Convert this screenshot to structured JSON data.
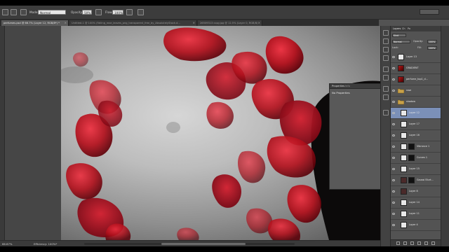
{
  "options_bar": {
    "mode_label": "Mode:",
    "mode_value": "Normal",
    "opacity_label": "Opacity:",
    "opacity_value": "50%",
    "flow_label": "Flow:",
    "flow_value": "100%"
  },
  "tabs": [
    {
      "label": "perfumes.psd @ 66.7% (Layer 12, RGB/8*) *",
      "active": true
    },
    {
      "label": "Untitled-1 @ 100% (Falling_rose_leaves_png_transparent_free_by_AbsolutelyStock.d...",
      "active": false
    },
    {
      "label": "26509313 copy.jpg @ 12.5% (Layer 0, RGB/8)",
      "active": false
    }
  ],
  "properties_panel": {
    "tab_properties": "Properties",
    "tab_info": "Info",
    "body_text": "No Properties"
  },
  "status_bar": {
    "zoom": "66.67%",
    "efficiency": "Efficiency: 100%*"
  },
  "layers_panel": {
    "tabs": [
      "Layers",
      "Ch",
      "Pa"
    ],
    "kind_label": "Kind",
    "blend_value": "Normal",
    "opacity_label": "Opacity:",
    "opacity_value": "100%",
    "fill_label": "Fill:",
    "fill_value": "100%",
    "lock_label": "Lock:",
    "layers": [
      {
        "name": "Layer 13",
        "thumb": "white",
        "selected": false,
        "mask": false,
        "indent": 0
      },
      {
        "name": "GRADIENT",
        "thumb": "red",
        "selected": false,
        "mask": false,
        "indent": 0
      },
      {
        "name": "perfume_top1_d...",
        "thumb": "red",
        "selected": false,
        "mask": false,
        "indent": 0
      },
      {
        "name": "rose",
        "thumb": "folder",
        "selected": false,
        "mask": false,
        "indent": 0
      },
      {
        "name": "shadow",
        "thumb": "folder",
        "selected": false,
        "mask": false,
        "indent": 0
      },
      {
        "name": "Layer 12",
        "thumb": "white",
        "selected": true,
        "mask": false,
        "indent": 1
      },
      {
        "name": "Layer 17",
        "thumb": "white",
        "selected": false,
        "mask": false,
        "indent": 1
      },
      {
        "name": "Layer 16",
        "thumb": "white",
        "selected": false,
        "mask": false,
        "indent": 1
      },
      {
        "name": "Vibrance 1",
        "thumb": "white",
        "selected": false,
        "mask": true,
        "indent": 1
      },
      {
        "name": "Curves 1",
        "thumb": "white",
        "selected": false,
        "mask": true,
        "indent": 1
      },
      {
        "name": "Layer 15",
        "thumb": "white",
        "selected": false,
        "mask": false,
        "indent": 1
      },
      {
        "name": "Gaussi Blurt...",
        "thumb": "dark",
        "selected": false,
        "mask": true,
        "indent": 1
      },
      {
        "name": "Layer 8",
        "thumb": "dark",
        "selected": false,
        "mask": false,
        "indent": 1
      },
      {
        "name": "Layer 14",
        "thumb": "white",
        "selected": false,
        "mask": false,
        "indent": 1
      },
      {
        "name": "Layer 11",
        "thumb": "white",
        "selected": false,
        "mask": false,
        "indent": 1
      },
      {
        "name": "Layer 4",
        "thumb": "white",
        "selected": false,
        "mask": false,
        "indent": 1
      }
    ]
  }
}
